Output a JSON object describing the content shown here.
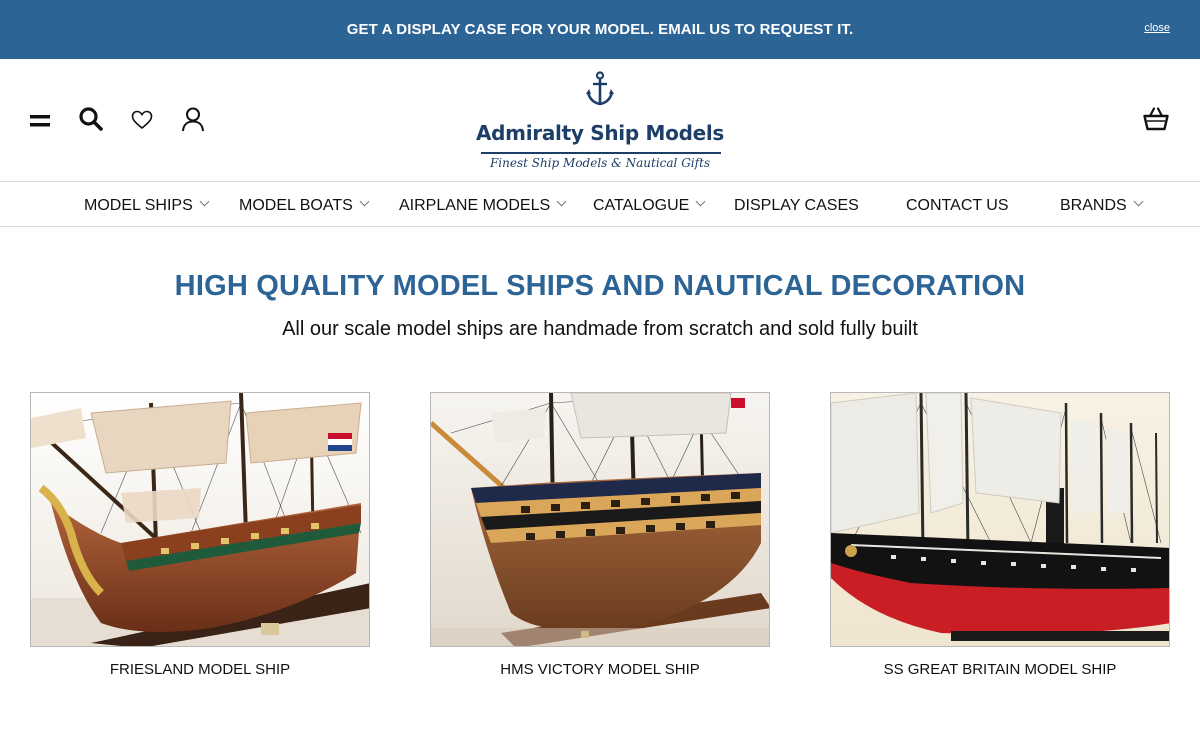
{
  "announcement": {
    "text": "GET A DISPLAY CASE FOR YOUR MODEL. EMAIL US TO REQUEST IT.",
    "close_label": "close"
  },
  "header": {
    "icons": {
      "menu": "menu-icon",
      "search": "search-icon",
      "wishlist": "heart-icon",
      "account": "user-icon",
      "cart": "basket-icon"
    },
    "logo": {
      "name": "Admiralty Ship Models",
      "tagline": "Finest Ship Models & Nautical Gifts"
    }
  },
  "nav": {
    "items": [
      {
        "label": "MODEL SHIPS",
        "has_dropdown": true
      },
      {
        "label": "MODEL BOATS",
        "has_dropdown": true
      },
      {
        "label": "AIRPLANE MODELS",
        "has_dropdown": true
      },
      {
        "label": "CATALOGUE",
        "has_dropdown": true
      },
      {
        "label": "DISPLAY CASES",
        "has_dropdown": false
      },
      {
        "label": "CONTACT US",
        "has_dropdown": false
      },
      {
        "label": "BRANDS",
        "has_dropdown": true
      }
    ]
  },
  "hero": {
    "title": "HIGH QUALITY MODEL SHIPS AND NAUTICAL DECORATION",
    "subtitle": "All our scale model ships are handmade from scratch and sold fully built"
  },
  "products": [
    {
      "title": "FRIESLAND MODEL SHIP"
    },
    {
      "title": "HMS VICTORY MODEL SHIP"
    },
    {
      "title": "SS GREAT BRITAIN MODEL SHIP"
    }
  ],
  "colors": {
    "brand_blue": "#2d6496",
    "logo_navy": "#1d3e66"
  }
}
